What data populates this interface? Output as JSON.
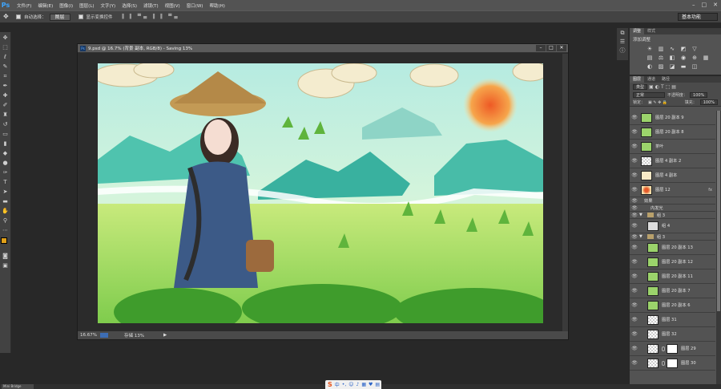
{
  "app": {
    "logo": "Ps"
  },
  "menubar": {
    "items": [
      "文件(F)",
      "编辑(E)",
      "图像(I)",
      "图层(L)",
      "文字(Y)",
      "选择(S)",
      "滤镜(T)",
      "视图(V)",
      "窗口(W)",
      "帮助(H)"
    ],
    "window_controls": [
      "–",
      "□",
      "✕"
    ]
  },
  "options": {
    "auto_select_label": "自动选择：",
    "auto_select_value": "图层",
    "show_transform_label": "显示变换控件",
    "workspace": "基本功能"
  },
  "document": {
    "title": "9.psd @ 16.7% (背景 副本, RGB/8) - Saving 13%",
    "zoom": "16.67%",
    "status": "存储 13%",
    "buttons": [
      "–",
      "□",
      "✕"
    ]
  },
  "adjustments": {
    "tabs": [
      "调整",
      "样式"
    ],
    "title": "添加调整"
  },
  "layers": {
    "tabs": [
      "图层",
      "通道",
      "路径"
    ],
    "filter": "类型",
    "blend_mode": "正常",
    "opacity_label": "不透明度：",
    "opacity_value": "100%",
    "lock_label": "锁定：",
    "fill_label": "填充：",
    "fill_value": "100%",
    "items": [
      {
        "name": "图层 20 副本 9",
        "thumb": "leaf"
      },
      {
        "name": "图层 20 副本 8",
        "thumb": "leaf"
      },
      {
        "name": "茶叶",
        "thumb": "leaf"
      },
      {
        "name": "图层 4 副本 2",
        "thumb": "checker"
      },
      {
        "name": "图层 4 副本",
        "thumb": "checker"
      },
      {
        "name": "图层 12",
        "thumb": "sun",
        "fx": "fx"
      },
      {
        "name": "效果",
        "small": true
      },
      {
        "name": "内发光",
        "small": true
      },
      {
        "name": "组 3",
        "small": true,
        "group": true
      },
      {
        "name": "组 4",
        "thumb": "grp"
      },
      {
        "name": "组 3",
        "small": true,
        "group": true
      },
      {
        "name": "图层 20 副本 13",
        "thumb": "leaf"
      },
      {
        "name": "图层 20 副本 12",
        "thumb": "leaf"
      },
      {
        "name": "图层 20 副本 11",
        "thumb": "leaf"
      },
      {
        "name": "图层 20 副本 7",
        "thumb": "leaf"
      },
      {
        "name": "图层 20 副本 6",
        "thumb": "leaf"
      },
      {
        "name": "图层 31",
        "thumb": "checker"
      },
      {
        "name": "图层 32",
        "thumb": "checker"
      },
      {
        "name": "图层 29",
        "thumb": "checker",
        "mask": true
      },
      {
        "name": "图层 30",
        "thumb": "checker",
        "mask": true
      }
    ]
  },
  "taskbar": {
    "minibridge": "Mini Bridge"
  },
  "ime": {
    "logo": "S",
    "mode": "中"
  },
  "colors": {
    "accent": "#3ea6ff",
    "fg_swatch": "#e0a019"
  }
}
